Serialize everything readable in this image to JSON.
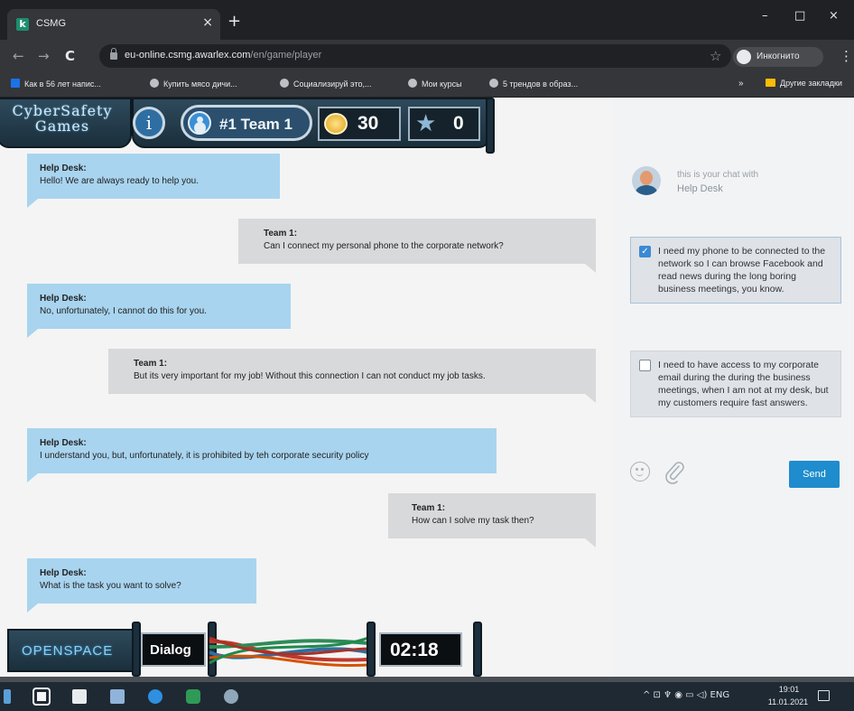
{
  "browser": {
    "tab_title": "CSMG",
    "tab_favicon_letter": "k",
    "tab_close": "×",
    "new_tab": "+",
    "window_controls": {
      "minimize": "–",
      "maximize": "□",
      "close": "×"
    },
    "nav": {
      "back": "←",
      "forward": "→",
      "reload": "C"
    },
    "url_host": "eu-online.csmg.awarlex.com",
    "url_path": "/en/game/player",
    "bookmark_star": "☆",
    "profile_label": "Инкогнито",
    "menu": "⋮",
    "bookmarks": [
      {
        "label": "Как в 56 лет напис..."
      },
      {
        "label": "Купить мясо дичи..."
      },
      {
        "label": "Социализируй это,..."
      },
      {
        "label": "Мои курсы"
      },
      {
        "label": "5 трендов в образ..."
      }
    ],
    "bookmarks_overflow": "»",
    "other_bookmarks": "Другие закладки"
  },
  "hud": {
    "logo": "CyberSafety Games",
    "logo_line1": "CyberSafety",
    "logo_line2": "Games",
    "info": "i",
    "team": "#1 Team 1",
    "coins": "30",
    "stars": "0",
    "star_glyph": "★"
  },
  "messages": [
    {
      "sender": "Help Desk:",
      "text": "Hello! We are always ready to help you."
    },
    {
      "sender": "Team 1:",
      "text": "Can I connect my personal phone to the corporate network?"
    },
    {
      "sender": "Help Desk:",
      "text": "No, unfortunately, I cannot do this for you."
    },
    {
      "sender": "Team 1:",
      "text": "But its very important for my job! Without this connection I can not conduct my job tasks."
    },
    {
      "sender": "Help Desk:",
      "text": "I understand you, but, unfortunately, it is prohibited by teh corporate security policy"
    },
    {
      "sender": "Team 1:",
      "text": "How can I solve my task then?"
    },
    {
      "sender": "Help Desk:",
      "text": "What is the task you want to solve?"
    }
  ],
  "bottom_hud": {
    "location": "OPENSPACE",
    "mode": "Dialog",
    "timer": "02:18"
  },
  "chat_panel": {
    "hint": "this is your chat with",
    "name": "Help Desk",
    "choices": [
      {
        "text": "I need my phone to be connected to the network so I can browse Facebook and read news during the long boring business meetings, you know.",
        "checked": true
      },
      {
        "text": "I need to have access to my corporate email during the during the business meetings, when I am not at my desk, but my customers require fast answers.",
        "checked": false
      }
    ],
    "check_glyph": "✓",
    "send": "Send"
  },
  "taskbar": {
    "tray": "^ ⊡ ♆ ◉ ▭ ◁) ENG",
    "time": "19:01",
    "date": "11.01.2021"
  },
  "colors": {
    "help_desk_bubble": "#a8d4ef",
    "team_bubble": "#d8d9db",
    "send_button": "#1e8ccd",
    "hud_dark": "#1b2f3c"
  }
}
